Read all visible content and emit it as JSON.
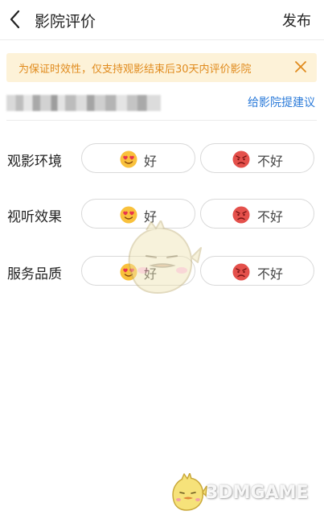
{
  "header": {
    "title": "影院评价",
    "publish_label": "发布"
  },
  "notice": {
    "text": "为保证时效性，仅支持观影结束后30天内评价影院"
  },
  "cinema": {
    "suggest_link": "给影院提建议"
  },
  "ratings": [
    {
      "label": "观影环境",
      "good_label": "好",
      "bad_label": "不好"
    },
    {
      "label": "视听效果",
      "good_label": "好",
      "bad_label": "不好"
    },
    {
      "label": "服务品质",
      "good_label": "好",
      "bad_label": "不好"
    }
  ],
  "watermark": {
    "brand": "3DMGAME"
  },
  "colors": {
    "notice_bg": "#fdf2d8",
    "notice_text": "#e08a1c",
    "link": "#2a7ad9",
    "pill_border": "#d9d9d9",
    "good_emoji": "#f9c13c",
    "bad_emoji": "#e4504b"
  },
  "icons": {
    "back": "chevron-left-icon",
    "close": "close-icon",
    "good": "heart-eyes-emoji-icon",
    "bad": "angry-face-emoji-icon"
  }
}
